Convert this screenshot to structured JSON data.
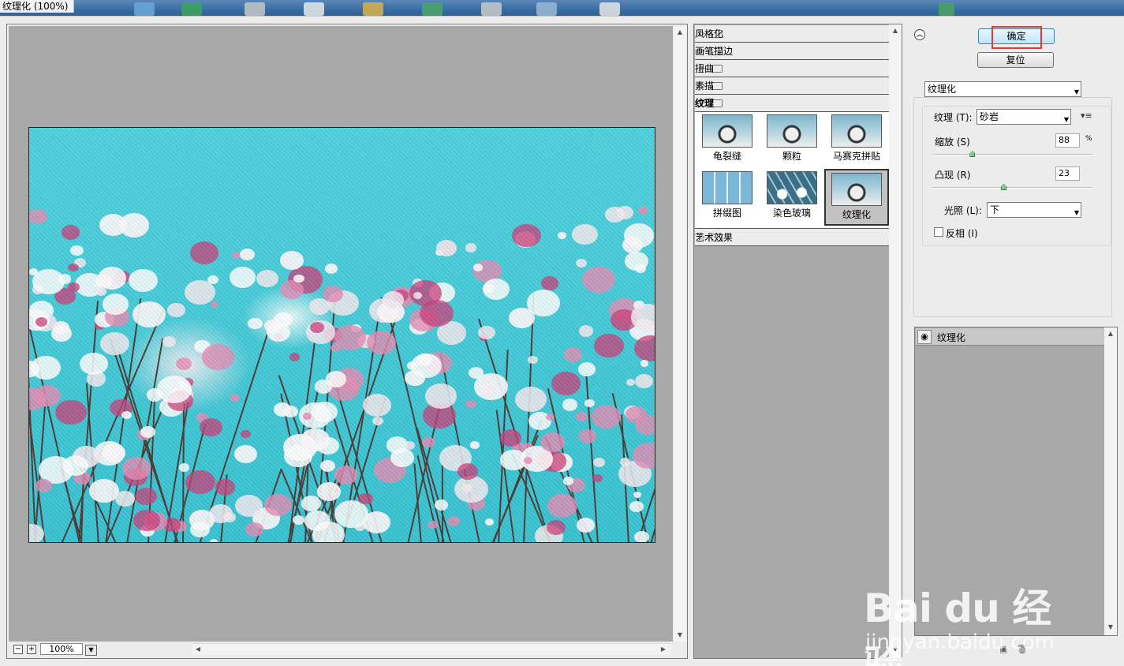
{
  "window": {
    "title": "纹理化 (100%)"
  },
  "preview": {
    "zoom_minus": "−",
    "zoom_plus": "+",
    "zoom_value": "100%"
  },
  "filter_categories": {
    "stylize": "风格化",
    "brush_strokes": "画笔描边",
    "distort": "扭曲",
    "sketch": "素描",
    "texture": "纹理",
    "artistic": "艺术效果"
  },
  "texture_filters": [
    "龟裂缝",
    "颗粒",
    "马赛克拼贴",
    "拼缀图",
    "染色玻璃",
    "纹理化"
  ],
  "selected_filter": "纹理化",
  "buttons": {
    "ok": "确定",
    "reset": "复位"
  },
  "filter_select": "纹理化",
  "settings": {
    "texture_label": "纹理 (T):",
    "texture_value": "砂岩",
    "scaling_label": "缩放 (S)",
    "scaling_value": "88",
    "scaling_unit": "%",
    "scaling_fraction": 0.88,
    "relief_label": "凸现 (R)",
    "relief_value": "23",
    "relief_fraction": 0.46,
    "light_label": "光照 (L):",
    "light_value": "下",
    "invert_label": "反相 (I)",
    "invert_checked": false
  },
  "layers": [
    {
      "name": "纹理化",
      "visible": true
    }
  ],
  "watermark": {
    "brand": "Bai du 经验",
    "url": "jingyan.baidu.com"
  },
  "colors": {
    "ok_highlight": "#e53935",
    "canvas_gray": "#a8a8a8",
    "sky": "#38c3d2"
  }
}
